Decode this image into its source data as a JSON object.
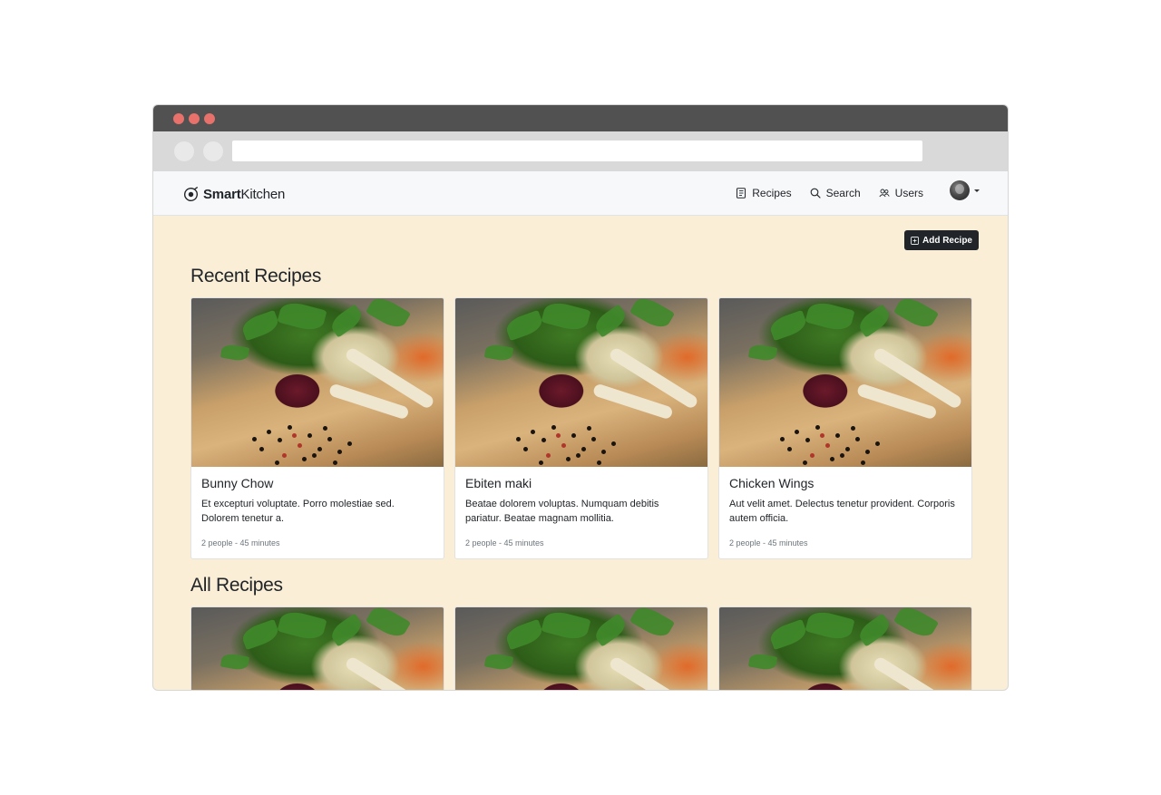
{
  "brand": {
    "bold": "Smart",
    "light": "Kitchen"
  },
  "nav": {
    "links": [
      {
        "label": "Recipes",
        "icon": "recipe-book-icon"
      },
      {
        "label": "Search",
        "icon": "search-icon"
      },
      {
        "label": "Users",
        "icon": "users-icon"
      }
    ]
  },
  "actions": {
    "add_recipe": "Add Recipe"
  },
  "sections": {
    "recent_title": "Recent Recipes",
    "all_title": "All Recipes"
  },
  "recent": [
    {
      "title": "Bunny Chow",
      "text": "Et excepturi voluptate. Porro molestiae sed. Dolorem tenetur a.",
      "meta": "2 people - 45 minutes"
    },
    {
      "title": "Ebiten maki",
      "text": "Beatae dolorem voluptas. Numquam debitis pariatur. Beatae magnam mollitia.",
      "meta": "2 people - 45 minutes"
    },
    {
      "title": "Chicken Wings",
      "text": "Aut velit amet. Delectus tenetur provident. Corporis autem officia.",
      "meta": "2 people - 45 minutes"
    }
  ],
  "colors": {
    "page_bg": "#fbeed6",
    "navbar_bg": "#f7f8fa",
    "button_dark": "#212529",
    "window_dot": "#e8716b"
  }
}
